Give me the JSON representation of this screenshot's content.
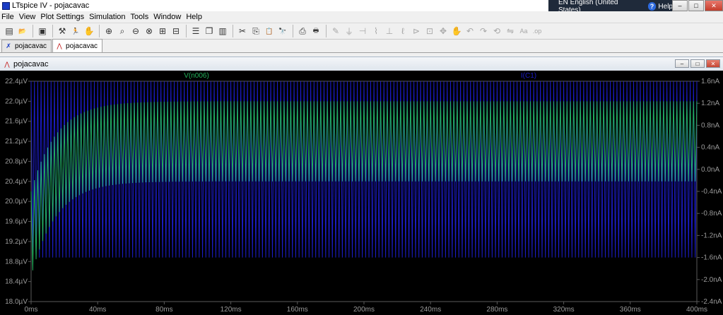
{
  "window": {
    "title": "LTspice IV - pojacavac",
    "language": "EN English (United States)",
    "help_label": "Help",
    "help_glyph": "?",
    "minimize": "–",
    "maximize": "□",
    "close": "✕"
  },
  "menu": [
    "File",
    "View",
    "Plot Settings",
    "Simulation",
    "Tools",
    "Window",
    "Help"
  ],
  "toolbar": [
    {
      "icon": "new-schematic-icon",
      "glyph": "▤"
    },
    {
      "icon": "open-icon",
      "glyph": "📂"
    },
    {
      "icon": "save-icon",
      "glyph": "▣"
    },
    {
      "icon": "control-panel-icon",
      "glyph": "⚒"
    },
    {
      "icon": "run-icon",
      "glyph": "🏃"
    },
    {
      "icon": "halt-icon",
      "glyph": "✋"
    },
    {
      "icon": "zoom-in-icon",
      "glyph": "⊕"
    },
    {
      "icon": "pan-icon",
      "glyph": "⌕"
    },
    {
      "icon": "zoom-out-icon",
      "glyph": "⊖"
    },
    {
      "icon": "zoom-cancel-icon",
      "glyph": "⊗"
    },
    {
      "icon": "autorange-icon",
      "glyph": "⊞"
    },
    {
      "icon": "fit-icon",
      "glyph": "⊟"
    },
    {
      "icon": "tile-horizontal-icon",
      "glyph": "☰"
    },
    {
      "icon": "cascade-icon",
      "glyph": "❐"
    },
    {
      "icon": "tile-vertical-icon",
      "glyph": "▥"
    },
    {
      "icon": "cut-icon",
      "glyph": "✂"
    },
    {
      "icon": "copy-icon",
      "glyph": "⎘"
    },
    {
      "icon": "paste-icon",
      "glyph": "📋"
    },
    {
      "icon": "find-icon",
      "glyph": "🔭"
    },
    {
      "icon": "print-preview-icon",
      "glyph": "⎙"
    },
    {
      "icon": "print-icon",
      "glyph": "🖶"
    },
    {
      "icon": "wire-icon",
      "glyph": "✎"
    },
    {
      "icon": "ground-icon",
      "glyph": "⏚"
    },
    {
      "icon": "label-icon",
      "glyph": "⊣"
    },
    {
      "icon": "resistor-icon",
      "glyph": "⌇"
    },
    {
      "icon": "capacitor-icon",
      "glyph": "⊥"
    },
    {
      "icon": "inductor-icon",
      "glyph": "ℓ"
    },
    {
      "icon": "diode-icon",
      "glyph": "⊳"
    },
    {
      "icon": "component-icon",
      "glyph": "⊡"
    },
    {
      "icon": "move-icon",
      "glyph": "✥"
    },
    {
      "icon": "drag-icon",
      "glyph": "✋"
    },
    {
      "icon": "undo-icon",
      "glyph": "↶"
    },
    {
      "icon": "redo-icon",
      "glyph": "↷"
    },
    {
      "icon": "rotate-icon",
      "glyph": "⟲"
    },
    {
      "icon": "mirror-icon",
      "glyph": "⇋"
    },
    {
      "icon": "text-icon",
      "glyph": "Aa"
    },
    {
      "icon": "spice-directive-icon",
      "glyph": ".op"
    }
  ],
  "tabs": [
    {
      "label": "pojacavac",
      "icon": "schematic-icon",
      "glyph": "✗",
      "active": false
    },
    {
      "label": "pojacavac",
      "icon": "waveform-icon",
      "glyph": "⋀",
      "active": true
    }
  ],
  "plot_window": {
    "title": "pojacavac",
    "buttons": [
      "–",
      "□",
      "✕"
    ]
  },
  "chart_data": {
    "type": "line",
    "title": "",
    "xlabel": "",
    "x_ticks": [
      "0ms",
      "40ms",
      "80ms",
      "120ms",
      "160ms",
      "200ms",
      "240ms",
      "280ms",
      "320ms",
      "360ms",
      "400ms"
    ],
    "xlim": [
      0,
      400
    ],
    "left_axis": {
      "unit": "µV",
      "ticks": [
        "22.4µV",
        "22.0µV",
        "21.6µV",
        "21.2µV",
        "20.8µV",
        "20.4µV",
        "20.0µV",
        "19.6µV",
        "19.2µV",
        "18.8µV",
        "18.4µV",
        "18.0µV"
      ],
      "ylim": [
        18.0,
        22.4
      ]
    },
    "right_axis": {
      "unit": "nA",
      "ticks": [
        "1.6nA",
        "1.2nA",
        "0.8nA",
        "0.4nA",
        "0.0nA",
        "-0.4nA",
        "-0.8nA",
        "-1.2nA",
        "-1.6nA",
        "-2.0nA",
        "-2.4nA"
      ],
      "ylim": [
        -2.4,
        1.6
      ]
    },
    "grid": false,
    "series": [
      {
        "name": "V(n006)",
        "axis": "left",
        "color": "#22b05a",
        "cycles": 200,
        "settled_max": 22.0,
        "settled_min": 20.4,
        "start_max": 20.2,
        "start_min": 18.5,
        "settle_time_ms": 45
      },
      {
        "name": "I(C1)",
        "axis": "right",
        "color": "#1c1cc8",
        "cycles": 200,
        "max": 1.6,
        "min": -1.6
      }
    ],
    "background": "#000000",
    "axis_text_color": "#9a9a9a"
  }
}
